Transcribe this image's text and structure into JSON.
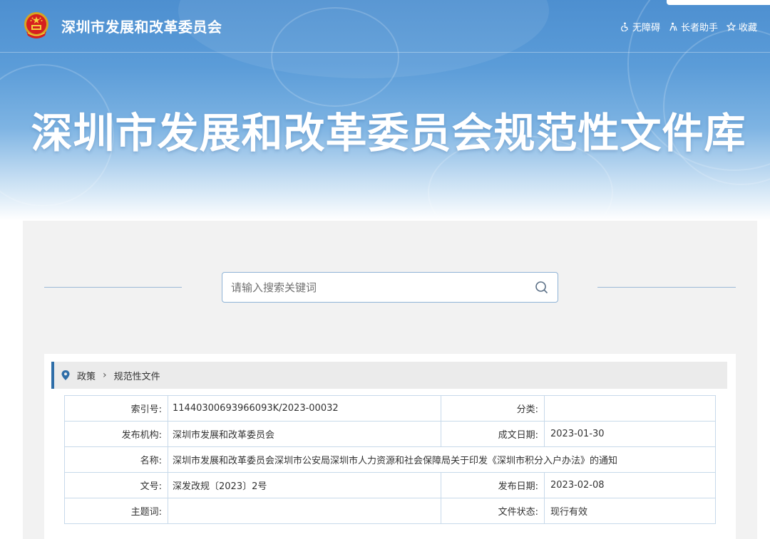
{
  "header": {
    "site_name": "深圳市发展和改革委员会",
    "links": [
      {
        "label": "无障碍",
        "icon": "accessibility-icon"
      },
      {
        "label": "长者助手",
        "icon": "elder-helper-icon"
      },
      {
        "label": "收藏",
        "icon": "star-icon"
      }
    ]
  },
  "hero": {
    "title": "深圳市发展和改革委员会规范性文件库"
  },
  "search": {
    "placeholder": "请输入搜索关键词",
    "value": ""
  },
  "breadcrumb": {
    "items": [
      "政策",
      "规范性文件"
    ]
  },
  "document_info": {
    "index_no_label": "索引号:",
    "index_no": "11440300693966093K/2023-00032",
    "category_label": "分类:",
    "category": "",
    "publisher_label": "发布机构:",
    "publisher": "深圳市发展和改革委员会",
    "written_date_label": "成文日期:",
    "written_date": "2023-01-30",
    "name_label": "名称:",
    "name": "深圳市发展和改革委员会深圳市公安局深圳市人力资源和社会保障局关于印发《深圳市积分入户办法》的通知",
    "doc_no_label": "文号:",
    "doc_no": "深发改规〔2023〕2号",
    "publish_date_label": "发布日期:",
    "publish_date": "2023-02-08",
    "subject_label": "主题词:",
    "subject": "",
    "status_label": "文件状态:",
    "status": "现行有效"
  },
  "colors": {
    "brand_blue": "#2f6ea8",
    "banner_blue": "#4d8fd0",
    "border": "#c7d9ea"
  }
}
